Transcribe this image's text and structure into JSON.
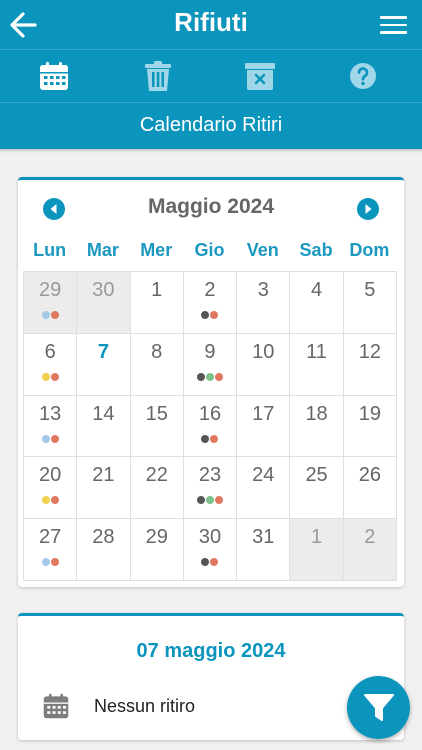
{
  "header": {
    "title": "Rifiuti",
    "back_icon": "arrow-left-icon",
    "menu_icon": "hamburger-menu-icon"
  },
  "toolbar": {
    "items": [
      {
        "icon": "calendar-icon"
      },
      {
        "icon": "trash-can-icon"
      },
      {
        "icon": "bin-x-icon"
      },
      {
        "icon": "help-icon"
      }
    ]
  },
  "subheader": {
    "title": "Calendario Ritiri"
  },
  "calendar": {
    "month_label": "Maggio 2024",
    "weekdays": [
      "Lun",
      "Mar",
      "Mer",
      "Gio",
      "Ven",
      "Sab",
      "Dom"
    ],
    "days": [
      {
        "n": "29",
        "other": true,
        "dots": [
          "#a6c8e8",
          "#e07860"
        ]
      },
      {
        "n": "30",
        "other": true,
        "dots": []
      },
      {
        "n": "1",
        "other": false,
        "dots": []
      },
      {
        "n": "2",
        "other": false,
        "dots": [
          "#555555",
          "#e07860"
        ]
      },
      {
        "n": "3",
        "other": false,
        "dots": []
      },
      {
        "n": "4",
        "other": false,
        "dots": []
      },
      {
        "n": "5",
        "other": false,
        "dots": []
      },
      {
        "n": "6",
        "other": false,
        "dots": [
          "#f2d050",
          "#e07860"
        ]
      },
      {
        "n": "7",
        "other": false,
        "today": true,
        "dots": []
      },
      {
        "n": "8",
        "other": false,
        "dots": []
      },
      {
        "n": "9",
        "other": false,
        "dots": [
          "#555555",
          "#7cc08a",
          "#e07860"
        ]
      },
      {
        "n": "10",
        "other": false,
        "dots": []
      },
      {
        "n": "11",
        "other": false,
        "dots": []
      },
      {
        "n": "12",
        "other": false,
        "dots": []
      },
      {
        "n": "13",
        "other": false,
        "dots": [
          "#a6c8e8",
          "#e07860"
        ]
      },
      {
        "n": "14",
        "other": false,
        "dots": []
      },
      {
        "n": "15",
        "other": false,
        "dots": []
      },
      {
        "n": "16",
        "other": false,
        "dots": [
          "#555555",
          "#e07860"
        ]
      },
      {
        "n": "17",
        "other": false,
        "dots": []
      },
      {
        "n": "18",
        "other": false,
        "dots": []
      },
      {
        "n": "19",
        "other": false,
        "dots": []
      },
      {
        "n": "20",
        "other": false,
        "dots": [
          "#f2d050",
          "#e07860"
        ]
      },
      {
        "n": "21",
        "other": false,
        "dots": []
      },
      {
        "n": "22",
        "other": false,
        "dots": []
      },
      {
        "n": "23",
        "other": false,
        "dots": [
          "#555555",
          "#7cc08a",
          "#e07860"
        ]
      },
      {
        "n": "24",
        "other": false,
        "dots": []
      },
      {
        "n": "25",
        "other": false,
        "dots": []
      },
      {
        "n": "26",
        "other": false,
        "dots": []
      },
      {
        "n": "27",
        "other": false,
        "dots": [
          "#a6c8e8",
          "#e07860"
        ]
      },
      {
        "n": "28",
        "other": false,
        "dots": []
      },
      {
        "n": "29",
        "other": false,
        "dots": []
      },
      {
        "n": "30",
        "other": false,
        "dots": [
          "#555555",
          "#e07860"
        ]
      },
      {
        "n": "31",
        "other": false,
        "dots": []
      },
      {
        "n": "1",
        "other": true,
        "dots": []
      },
      {
        "n": "2",
        "other": true,
        "dots": []
      }
    ]
  },
  "selected_day": {
    "date_label": "07 maggio 2024",
    "message": "Nessun ritiro",
    "icon": "calendar-icon"
  },
  "fab": {
    "icon": "filter-icon"
  },
  "colors": {
    "accent": "#0b94bc",
    "background": "#f0f0f0"
  }
}
